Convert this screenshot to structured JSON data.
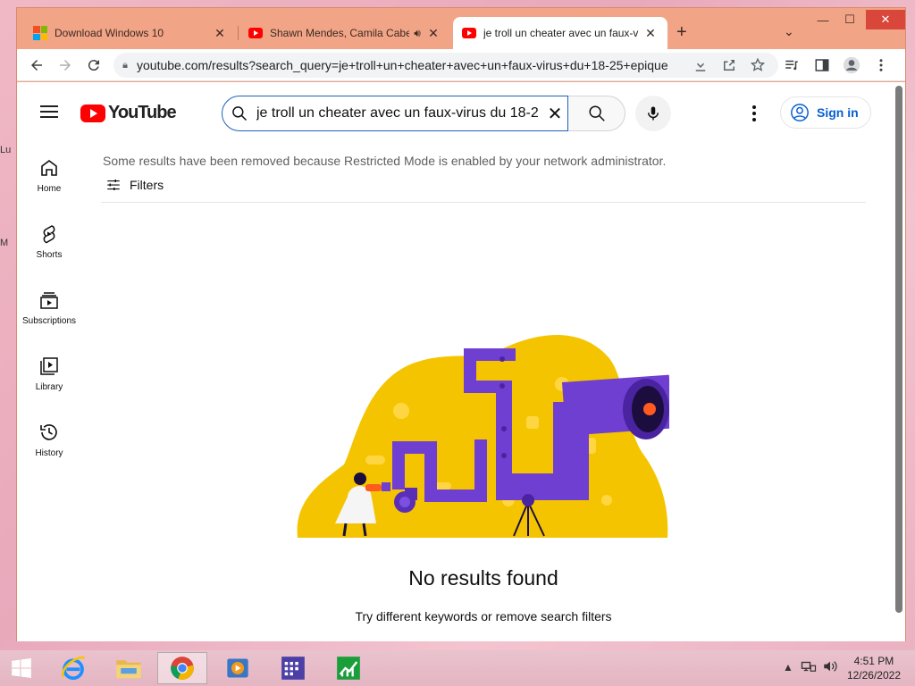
{
  "browser": {
    "tabs": [
      {
        "title": "Download Windows 10",
        "favicon": "windows-logo-icon"
      },
      {
        "title": "Shawn Mendes, Camila Cabe",
        "favicon": "youtube-icon",
        "audio": true
      },
      {
        "title": "je troll un cheater avec un faux-v",
        "favicon": "youtube-icon",
        "active": true
      }
    ],
    "url": "youtube.com/results?search_query=je+troll+un+cheater+avec+un+faux-virus+du+18-25+epique",
    "window_controls": {
      "minimize": "—",
      "maximize": "☐",
      "close": "✕"
    }
  },
  "youtube": {
    "logo_text": "YouTube",
    "search": {
      "query": "je troll un cheater avec un faux-virus du 18-2",
      "clear": "✕"
    },
    "signin_label": "Sign in",
    "guide": [
      {
        "label": "Home",
        "icon": "home-icon"
      },
      {
        "label": "Shorts",
        "icon": "shorts-icon"
      },
      {
        "label": "Subscriptions",
        "icon": "subscriptions-icon"
      },
      {
        "label": "Library",
        "icon": "library-icon"
      },
      {
        "label": "History",
        "icon": "history-icon"
      }
    ],
    "restricted_notice": "Some results have been removed because Restricted Mode is enabled by your network administrator.",
    "filters_label": "Filters",
    "no_results_title": "No results found",
    "no_results_hint": "Try different keywords or remove search filters"
  },
  "taskbar": {
    "time": "4:51 PM",
    "date": "12/26/2022",
    "apps": [
      "start-icon",
      "internet-explorer-icon",
      "file-explorer-icon",
      "chrome-icon",
      "media-player-icon",
      "calendar-app-icon",
      "stock-chart-app-icon"
    ]
  },
  "colors": {
    "youtube_red": "#ff0000",
    "link_blue": "#065fd4",
    "titlebar": "#f2a487",
    "illustration_yellow": "#f5c400",
    "illustration_purple": "#6f3fd1"
  }
}
